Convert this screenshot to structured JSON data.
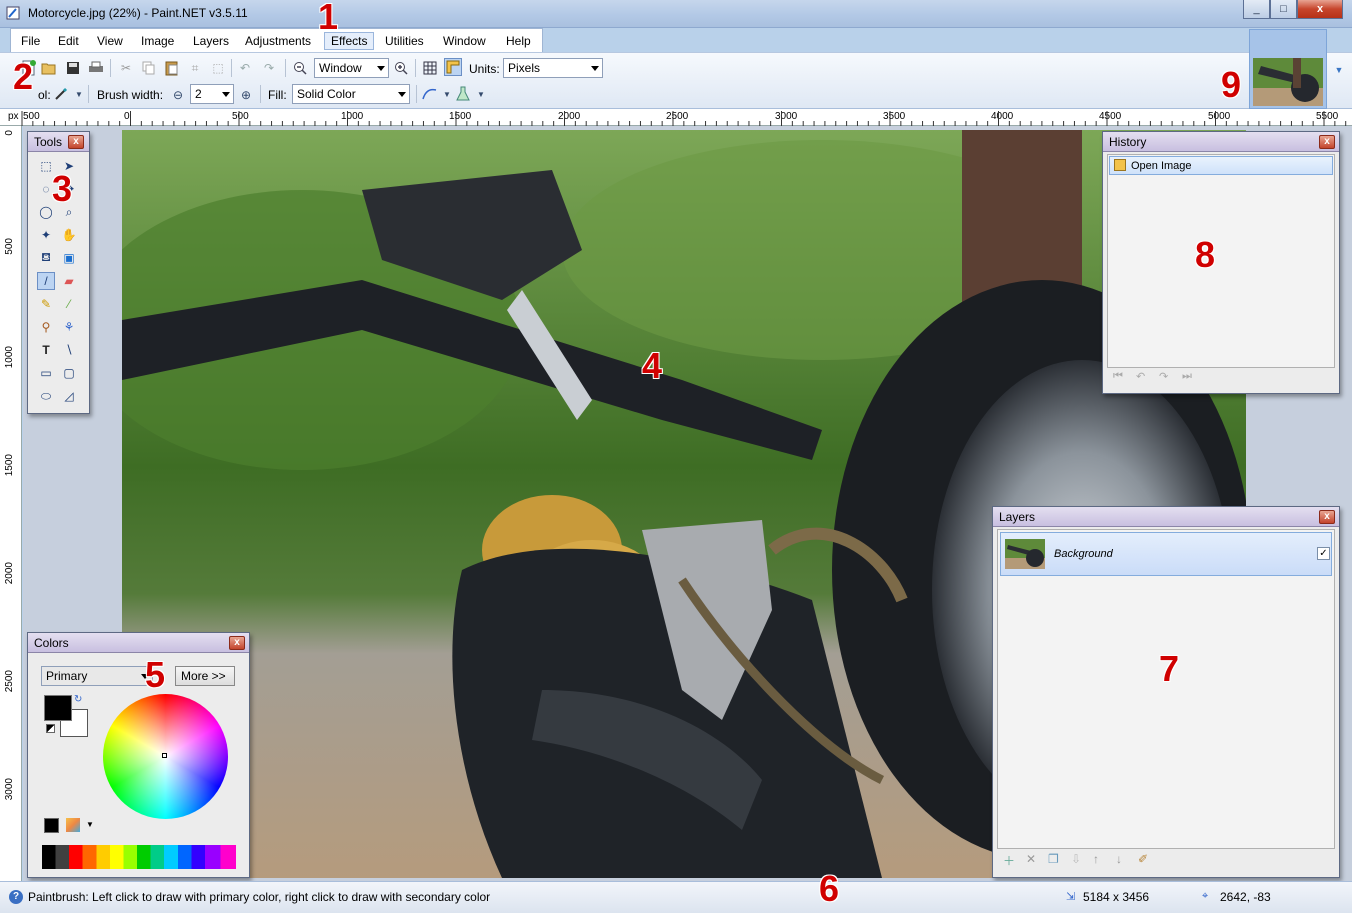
{
  "window": {
    "title": "Motorcycle.jpg (22%) - Paint.NET v3.5.11",
    "buttons": {
      "minimize": "_",
      "maximize": "□",
      "close": "x"
    }
  },
  "menu": {
    "items": [
      "File",
      "Edit",
      "View",
      "Image",
      "Layers",
      "Adjustments",
      "Effects",
      "Utilities",
      "Window",
      "Help"
    ]
  },
  "toolbar": {
    "zoom_value": "Window",
    "units_label": "Units:",
    "units_value": "Pixels",
    "tool_label": "ol:",
    "brush_width_label": "Brush width:",
    "brush_width_value": "2",
    "fill_label": "Fill:",
    "fill_value": "Solid Color"
  },
  "ruler": {
    "unit": "px",
    "h_ticks": [
      "500",
      "0",
      "500",
      "1000",
      "1500",
      "2000",
      "2500",
      "3000",
      "3500",
      "4000",
      "4500",
      "5000",
      "5500"
    ],
    "v_ticks": [
      "0",
      "500",
      "1000",
      "1500",
      "2000",
      "2500",
      "3000"
    ]
  },
  "tools_panel": {
    "title": "Tools"
  },
  "colors_panel": {
    "title": "Colors",
    "mode": "Primary",
    "more_button": "More >>",
    "primary_color": "#000000",
    "secondary_color": "#ffffff"
  },
  "history_panel": {
    "title": "History",
    "items": [
      "Open Image"
    ]
  },
  "layers_panel": {
    "title": "Layers",
    "layers": [
      {
        "name": "Background",
        "visible": true
      }
    ]
  },
  "status": {
    "help_text": "Paintbrush: Left click to draw with primary color, right click to draw with secondary color",
    "image_size": "5184 x 3456",
    "cursor_position": "2642, -83"
  },
  "annotations": [
    "1",
    "2",
    "3",
    "4",
    "5",
    "6",
    "7",
    "8",
    "9"
  ],
  "colors": {
    "accent": "#3a76c4",
    "annotation_red": "#d00000"
  }
}
